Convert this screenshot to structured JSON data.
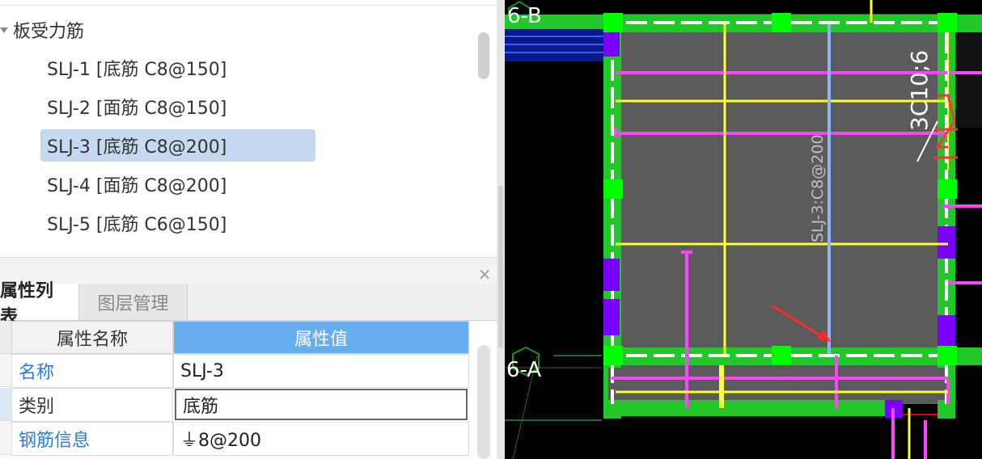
{
  "tree": {
    "parent_label": "板受力筋",
    "items": [
      {
        "label": "SLJ-1 [底筋 C8@150]",
        "selected": false
      },
      {
        "label": "SLJ-2 [面筋 C8@150]",
        "selected": false
      },
      {
        "label": "SLJ-3 [底筋 C8@200]",
        "selected": true
      },
      {
        "label": "SLJ-4 [面筋 C8@200]",
        "selected": false
      },
      {
        "label": "SLJ-5 [底筋 C6@150]",
        "selected": false
      }
    ]
  },
  "panel": {
    "close_glyph": "×",
    "tabs": [
      "属性列表",
      "图层管理"
    ],
    "active_tab": "属性列表"
  },
  "properties": {
    "header_name": "属性名称",
    "header_value": "属性值",
    "rows": [
      {
        "name": "名称",
        "value": "SLJ-3"
      },
      {
        "name": "类别",
        "value": "底筋"
      },
      {
        "name": "钢筋信息",
        "value": "⏚8@200"
      }
    ]
  },
  "cad": {
    "labels": {
      "grid_top": "6-B",
      "grid_left": "6-A",
      "rebar_annotation": "SLJ-3:C8@200",
      "beam_annotation": "3C10;6"
    },
    "colors": {
      "background": "#000000",
      "slab": "#5a5a5a",
      "beam": "#22c82a",
      "column": "#00ff00",
      "bottom_rebar": "#ffff33",
      "top_rebar": "#ff44ff",
      "selected_rebar": "#8fb2ff",
      "wall": "#7a00ff",
      "arrow": "#ff3333"
    }
  }
}
